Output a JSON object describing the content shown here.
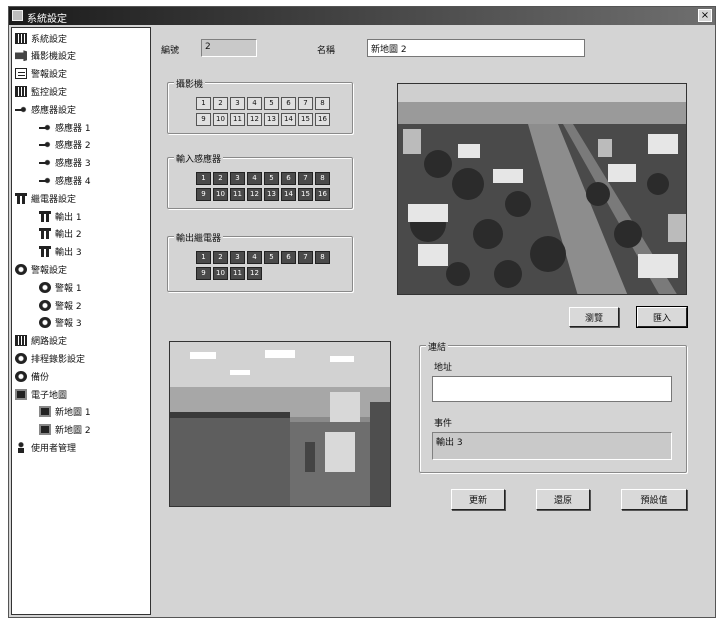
{
  "window": {
    "title": "系統設定",
    "close_glyph": "×"
  },
  "sidebar": {
    "items": [
      {
        "label": "系統設定",
        "icon": "grid-icon"
      },
      {
        "label": "攝影機設定",
        "icon": "camera-icon"
      },
      {
        "label": "警報設定",
        "icon": "document-icon"
      },
      {
        "label": "監控設定",
        "icon": "grid-icon"
      },
      {
        "label": "感應器設定",
        "icon": "sensor-icon"
      },
      {
        "label": "感應器 1",
        "icon": "sensor-icon"
      },
      {
        "label": "感應器 2",
        "icon": "sensor-icon"
      },
      {
        "label": "感應器 3",
        "icon": "sensor-icon"
      },
      {
        "label": "感應器 4",
        "icon": "sensor-icon"
      },
      {
        "label": "繼電器設定",
        "icon": "relay-icon"
      },
      {
        "label": "輸出 1",
        "icon": "relay-icon"
      },
      {
        "label": "輸出 2",
        "icon": "relay-icon"
      },
      {
        "label": "輸出 3",
        "icon": "relay-icon"
      },
      {
        "label": "警報設定",
        "icon": "alarm-icon"
      },
      {
        "label": "警報 1",
        "icon": "alarm-icon"
      },
      {
        "label": "警報 2",
        "icon": "alarm-icon"
      },
      {
        "label": "警報 3",
        "icon": "alarm-icon"
      },
      {
        "label": "網路設定",
        "icon": "grid-icon"
      },
      {
        "label": "排程錄影設定",
        "icon": "alarm-icon"
      },
      {
        "label": "備份",
        "icon": "alarm-icon"
      },
      {
        "label": "電子地圖",
        "icon": "map-icon"
      },
      {
        "label": "新地圖 1",
        "icon": "map-icon"
      },
      {
        "label": "新地圖 2",
        "icon": "map-icon"
      },
      {
        "label": "使用者管理",
        "icon": "person-icon"
      }
    ]
  },
  "form": {
    "id_label": "編號",
    "id_value": "2",
    "name_label": "名稱",
    "name_value": "新地圖 2"
  },
  "camera_group": {
    "legend": "攝影機",
    "row1": [
      "1",
      "2",
      "3",
      "4",
      "5",
      "6",
      "7",
      "8"
    ],
    "row2": [
      "9",
      "10",
      "11",
      "12",
      "13",
      "14",
      "15",
      "16"
    ]
  },
  "input_sensor_group": {
    "legend": "輸入感應器",
    "row1": [
      "1",
      "2",
      "3",
      "4",
      "5",
      "6",
      "7",
      "8"
    ],
    "row2": [
      "9",
      "10",
      "11",
      "12",
      "13",
      "14",
      "15",
      "16"
    ]
  },
  "output_relay_group": {
    "legend": "輸出繼電器",
    "row1": [
      "1",
      "2",
      "3",
      "4",
      "5",
      "6",
      "7",
      "8"
    ],
    "row2": [
      "9",
      "10",
      "11",
      "12"
    ]
  },
  "map_buttons": {
    "browse": "瀏覽",
    "import": "匯入"
  },
  "link_group": {
    "legend": "連結",
    "address_label": "地址",
    "address_value": "",
    "event_label": "事件",
    "event_value": "輸出 3"
  },
  "bottom_buttons": {
    "update": "更新",
    "restore": "還原",
    "preset": "預設值"
  }
}
